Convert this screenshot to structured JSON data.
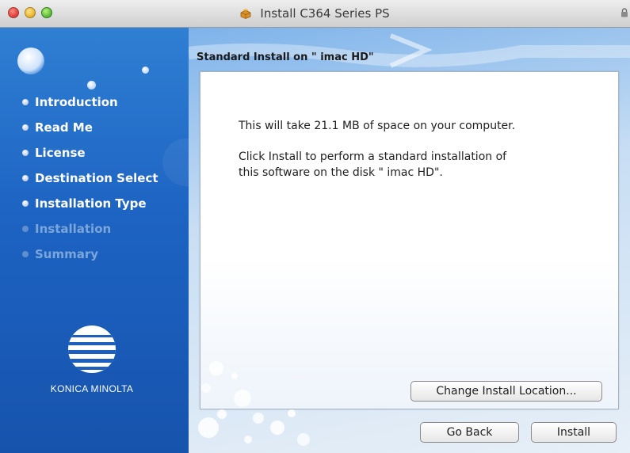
{
  "window": {
    "title": "Install C364 Series PS",
    "icons": {
      "installer": "installer-box-icon",
      "lock": "lock-icon"
    },
    "traffic_lights": [
      "close",
      "minimize",
      "zoom"
    ]
  },
  "sidebar": {
    "steps": [
      {
        "label": "Introduction",
        "state": "complete"
      },
      {
        "label": "Read Me",
        "state": "complete"
      },
      {
        "label": "License",
        "state": "complete"
      },
      {
        "label": "Destination Select",
        "state": "complete"
      },
      {
        "label": "Installation Type",
        "state": "current"
      },
      {
        "label": "Installation",
        "state": "pending"
      },
      {
        "label": "Summary",
        "state": "pending"
      }
    ],
    "logo_text": "KONICA MINOLTA"
  },
  "main": {
    "pane_title": "Standard Install on \" imac HD\"",
    "message_lines": [
      "This will take 21.1 MB of space on your computer.",
      "Click Install to perform a standard installation of",
      "this software on the disk \" imac HD\"."
    ],
    "change_location_button": "Change Install Location...",
    "go_back_button": "Go Back",
    "install_button": "Install"
  },
  "colors": {
    "sidebar_blue": "#1d63c2",
    "inactive_step": "#7aa6db",
    "titlebar": "#d6d6d6"
  }
}
